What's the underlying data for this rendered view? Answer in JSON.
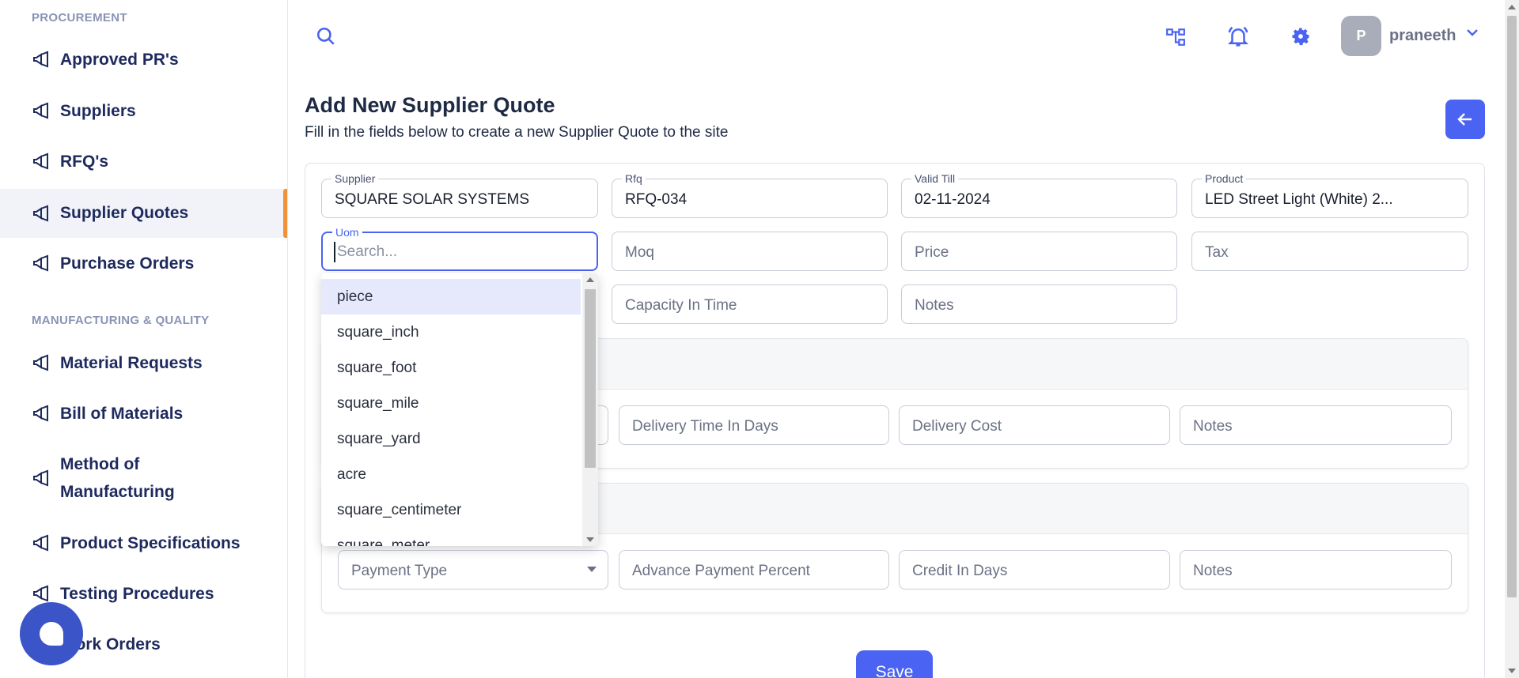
{
  "sidebar": {
    "sections": [
      {
        "title": "PROCUREMENT",
        "items": [
          "Approved PR's",
          "Suppliers",
          "RFQ's",
          "Supplier Quotes",
          "Purchase Orders"
        ]
      },
      {
        "title": "MANUFACTURING & QUALITY",
        "items": [
          "Material Requests",
          "Bill of Materials",
          "Method of Manufacturing",
          "Product Specifications",
          "Testing Procedures",
          "Work Orders"
        ]
      }
    ],
    "active_item": "Supplier Quotes"
  },
  "topbar": {
    "avatar_initial": "P",
    "username": "praneeth",
    "icons": [
      "search-icon",
      "hierarchy-icon",
      "bell-icon",
      "gear-icon",
      "chevron-down-icon"
    ]
  },
  "page": {
    "title": "Add New Supplier Quote",
    "subtitle": "Fill in the fields below to create a new Supplier Quote to the site"
  },
  "form": {
    "supplier": {
      "label": "Supplier",
      "value": "SQUARE SOLAR SYSTEMS"
    },
    "rfq": {
      "label": "Rfq",
      "value": "RFQ-034"
    },
    "valid_till": {
      "label": "Valid Till",
      "value": "02-11-2024"
    },
    "product": {
      "label": "Product",
      "value": "LED Street Light (White) 2..."
    },
    "uom": {
      "label": "Uom",
      "placeholder": "Search..."
    },
    "moq": {
      "placeholder": "Moq"
    },
    "price": {
      "placeholder": "Price"
    },
    "tax": {
      "placeholder": "Tax"
    },
    "capacity_in_time": {
      "placeholder": "Capacity In Time"
    },
    "notes1": {
      "placeholder": "Notes"
    },
    "delivery": {
      "time_in_days": {
        "placeholder": "Delivery Time In Days"
      },
      "cost": {
        "placeholder": "Delivery Cost"
      },
      "notes": {
        "placeholder": "Notes"
      }
    },
    "payment": {
      "type": {
        "placeholder": "Payment Type"
      },
      "advance_percent": {
        "placeholder": "Advance Payment Percent"
      },
      "credit_days": {
        "placeholder": "Credit In Days"
      },
      "notes": {
        "placeholder": "Notes"
      }
    },
    "save_label": "Save"
  },
  "uom_dropdown": {
    "options": [
      "piece",
      "square_inch",
      "square_foot",
      "square_mile",
      "square_yard",
      "acre",
      "square_centimeter",
      "square_meter"
    ],
    "highlighted": "piece"
  },
  "colors": {
    "accent": "#4a63f2",
    "active_marker": "#f0923a",
    "nav_text": "#1e2a5e"
  }
}
